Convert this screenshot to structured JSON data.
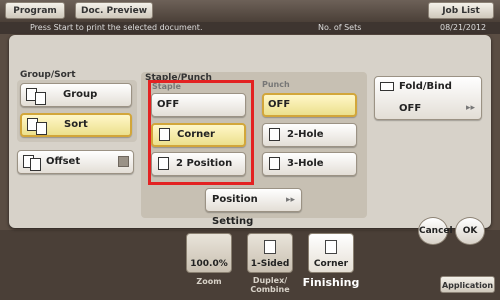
{
  "top": {
    "program": "Program",
    "doc_preview": "Doc. Preview",
    "job_list": "Job List",
    "message": "Press Start to print the selected document.",
    "sets_label": "No. of Sets",
    "date": "08/21/2012"
  },
  "group_sort": {
    "header": "Group/Sort",
    "group": "Group",
    "sort": "Sort",
    "offset": "Offset"
  },
  "staple_punch": {
    "header": "Staple/Punch",
    "staple_header": "Staple",
    "staple_off": "OFF",
    "corner": "Corner",
    "two_position": "2 Position",
    "punch_header": "Punch",
    "punch_off": "OFF",
    "two_hole": "2-Hole",
    "three_hole": "3-Hole",
    "position_setting": "Position Setting"
  },
  "fold_bind": {
    "header": "Fold/Bind",
    "value": "OFF"
  },
  "actions": {
    "cancel": "Cancel",
    "ok": "OK"
  },
  "bottom": {
    "zoom_value": "100.0%",
    "zoom_label": "Zoom",
    "duplex_value": "1-Sided",
    "duplex_label": "Duplex/ Combine",
    "finishing_value": "Corner",
    "finishing_label": "Finishing",
    "application": "Application"
  },
  "colors": {
    "selected_fill": "#ece08c",
    "selected_border": "#d2a63a",
    "highlight_box": "#e32222",
    "panel_bg": "#d7d2c9"
  }
}
